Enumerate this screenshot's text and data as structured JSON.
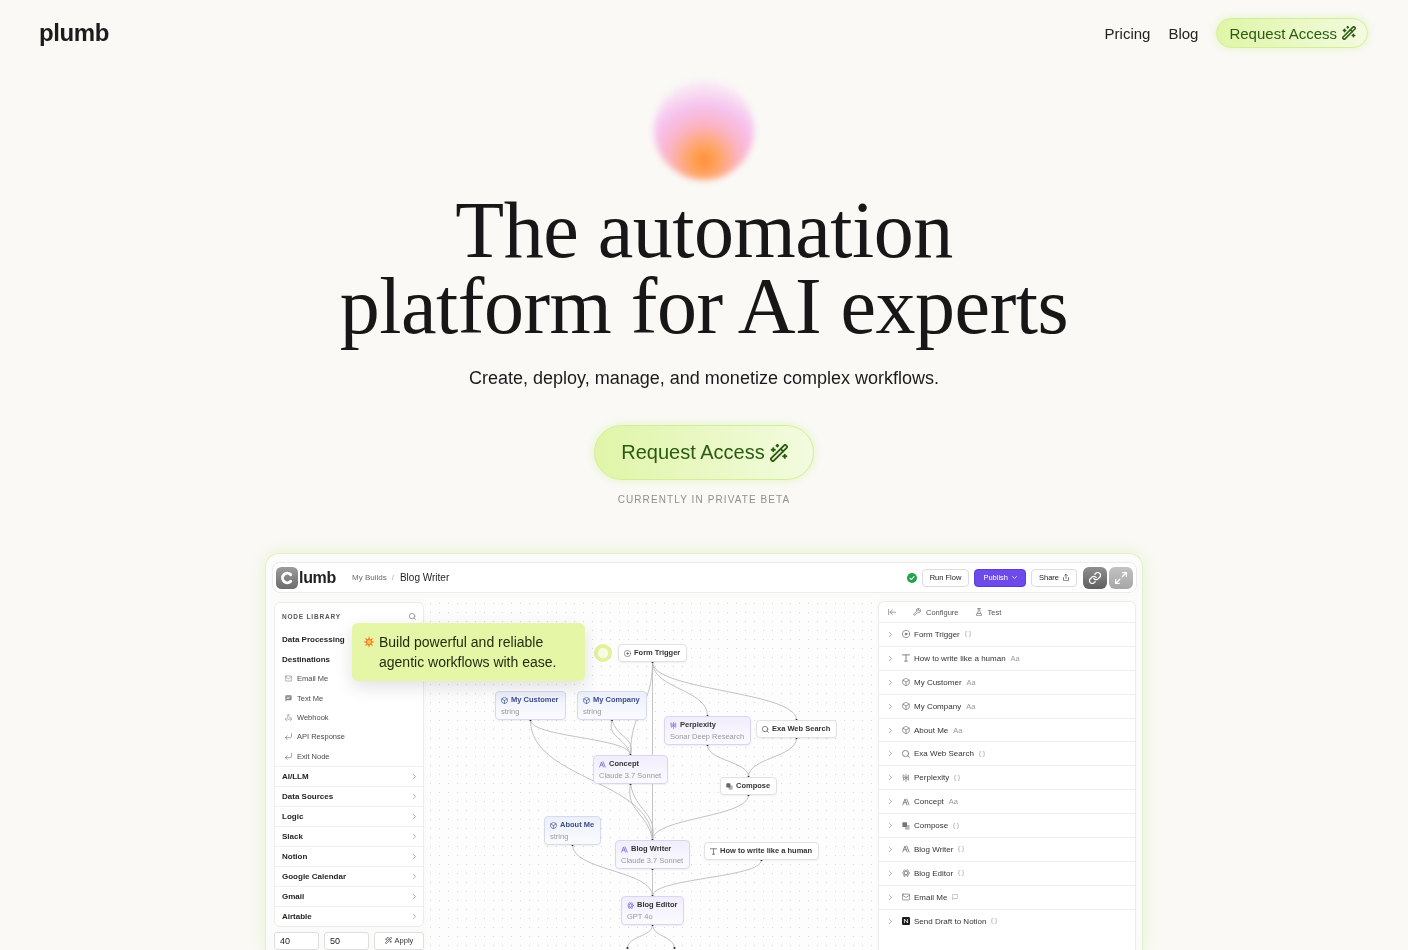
{
  "header": {
    "logo": "plumb",
    "nav": [
      "Pricing",
      "Blog"
    ],
    "cta": "Request Access"
  },
  "hero": {
    "title": "The automation platform for AI experts",
    "subtitle": "Create, deploy, manage, and monetize complex workflows.",
    "cta": "Request Access",
    "note": "CURRENTLY IN PRIVATE BETA"
  },
  "app": {
    "logo_text": "lumb",
    "breadcrumb": {
      "items": [
        "My Builds",
        "Blog Writer"
      ],
      "separator": "/"
    },
    "status": {
      "ok": true
    },
    "actions": [
      {
        "label": "Run Flow",
        "kind": "plain"
      },
      {
        "label": "Publish",
        "kind": "primary"
      },
      {
        "label": "Share",
        "kind": "share"
      }
    ],
    "tools": [
      {
        "kind": "link"
      },
      {
        "kind": "expand"
      }
    ],
    "node_library": {
      "title": "NODE LIBRARY",
      "groups": [
        {
          "label": "Data Processing",
          "expanded": true
        },
        {
          "label": "Destinations",
          "expanded": true,
          "items": [
            {
              "label": "Email Me",
              "kind": "email"
            },
            {
              "label": "Text Me",
              "kind": "sms"
            },
            {
              "label": "Webhook",
              "kind": "webhook"
            },
            {
              "label": "API Response",
              "kind": "response"
            },
            {
              "label": "Exit Node",
              "kind": "exit"
            }
          ]
        },
        {
          "label": "AI/LLM",
          "expanded": false
        },
        {
          "label": "Data Sources",
          "expanded": false
        },
        {
          "label": "Logic",
          "expanded": false
        },
        {
          "label": "Slack",
          "expanded": false
        },
        {
          "label": "Notion",
          "expanded": false
        },
        {
          "label": "Google Calendar",
          "expanded": false
        },
        {
          "label": "Gmail",
          "expanded": false
        },
        {
          "label": "Airtable",
          "expanded": false
        }
      ],
      "fields": [
        "40",
        "50"
      ],
      "apply": "Apply"
    },
    "callout": "Build powerful and reliable agentic workflows with ease.",
    "canvas": {
      "nodes": [
        {
          "title": "Form Trigger",
          "kind": "trigger"
        },
        {
          "title": "My Customer",
          "subtitle": "string",
          "kind": "variable"
        },
        {
          "title": "My Company",
          "subtitle": "string",
          "kind": "variable"
        },
        {
          "title": "Perplexity",
          "subtitle": "Sonar Deep Research",
          "kind": "perplexity"
        },
        {
          "title": "Exa Web Search",
          "kind": "search"
        },
        {
          "title": "Concept",
          "subtitle": "Claude 3.7 Sonnet",
          "kind": "claude"
        },
        {
          "title": "Compose",
          "kind": "compose"
        },
        {
          "title": "About Me",
          "subtitle": "string",
          "kind": "variable"
        },
        {
          "title": "Blog Writer",
          "subtitle": "Claude 3.7 Sonnet",
          "kind": "claude"
        },
        {
          "title": "How to write like a human",
          "kind": "text"
        },
        {
          "title": "Blog Editor",
          "subtitle": "GPT 4o",
          "kind": "gpt"
        }
      ]
    },
    "inspector": {
      "tabs": [
        {
          "label": "Configure",
          "kind": "configure"
        },
        {
          "label": "Test",
          "kind": "test"
        }
      ],
      "rows": [
        {
          "label": "Form Trigger",
          "kind": "trigger",
          "expanded": false,
          "output": {
            "kind": "braces"
          }
        },
        {
          "label": "How to write like a human",
          "kind": "text",
          "expanded": false,
          "output": {
            "kind": "text",
            "label": "Aa"
          }
        },
        {
          "label": "My Customer",
          "kind": "variable",
          "expanded": false,
          "output": {
            "kind": "text",
            "label": "Aa"
          }
        },
        {
          "label": "My Company",
          "kind": "variable",
          "expanded": false,
          "output": {
            "kind": "text",
            "label": "Aa"
          }
        },
        {
          "label": "About Me",
          "kind": "variable",
          "expanded": false,
          "output": {
            "kind": "text",
            "label": "Aa"
          }
        },
        {
          "label": "Exa Web Search",
          "kind": "search",
          "expanded": false,
          "output": {
            "kind": "braces"
          }
        },
        {
          "label": "Perplexity",
          "kind": "perplexity",
          "expanded": false,
          "output": {
            "kind": "braces"
          }
        },
        {
          "label": "Concept",
          "kind": "claude",
          "expanded": false,
          "output": {
            "kind": "text",
            "label": "Aa"
          }
        },
        {
          "label": "Compose",
          "kind": "compose",
          "expanded": false,
          "output": {
            "kind": "braces"
          }
        },
        {
          "label": "Blog Writer",
          "kind": "claude",
          "expanded": false,
          "output": {
            "kind": "braces"
          }
        },
        {
          "label": "Blog Editor",
          "kind": "gpt",
          "expanded": false,
          "output": {
            "kind": "braces"
          }
        },
        {
          "label": "Email Me",
          "kind": "email",
          "expanded": false,
          "output": {
            "kind": "message"
          }
        },
        {
          "label": "Send Draft to Notion",
          "kind": "notion",
          "expanded": false,
          "output": {
            "kind": "braces"
          }
        }
      ]
    }
  }
}
